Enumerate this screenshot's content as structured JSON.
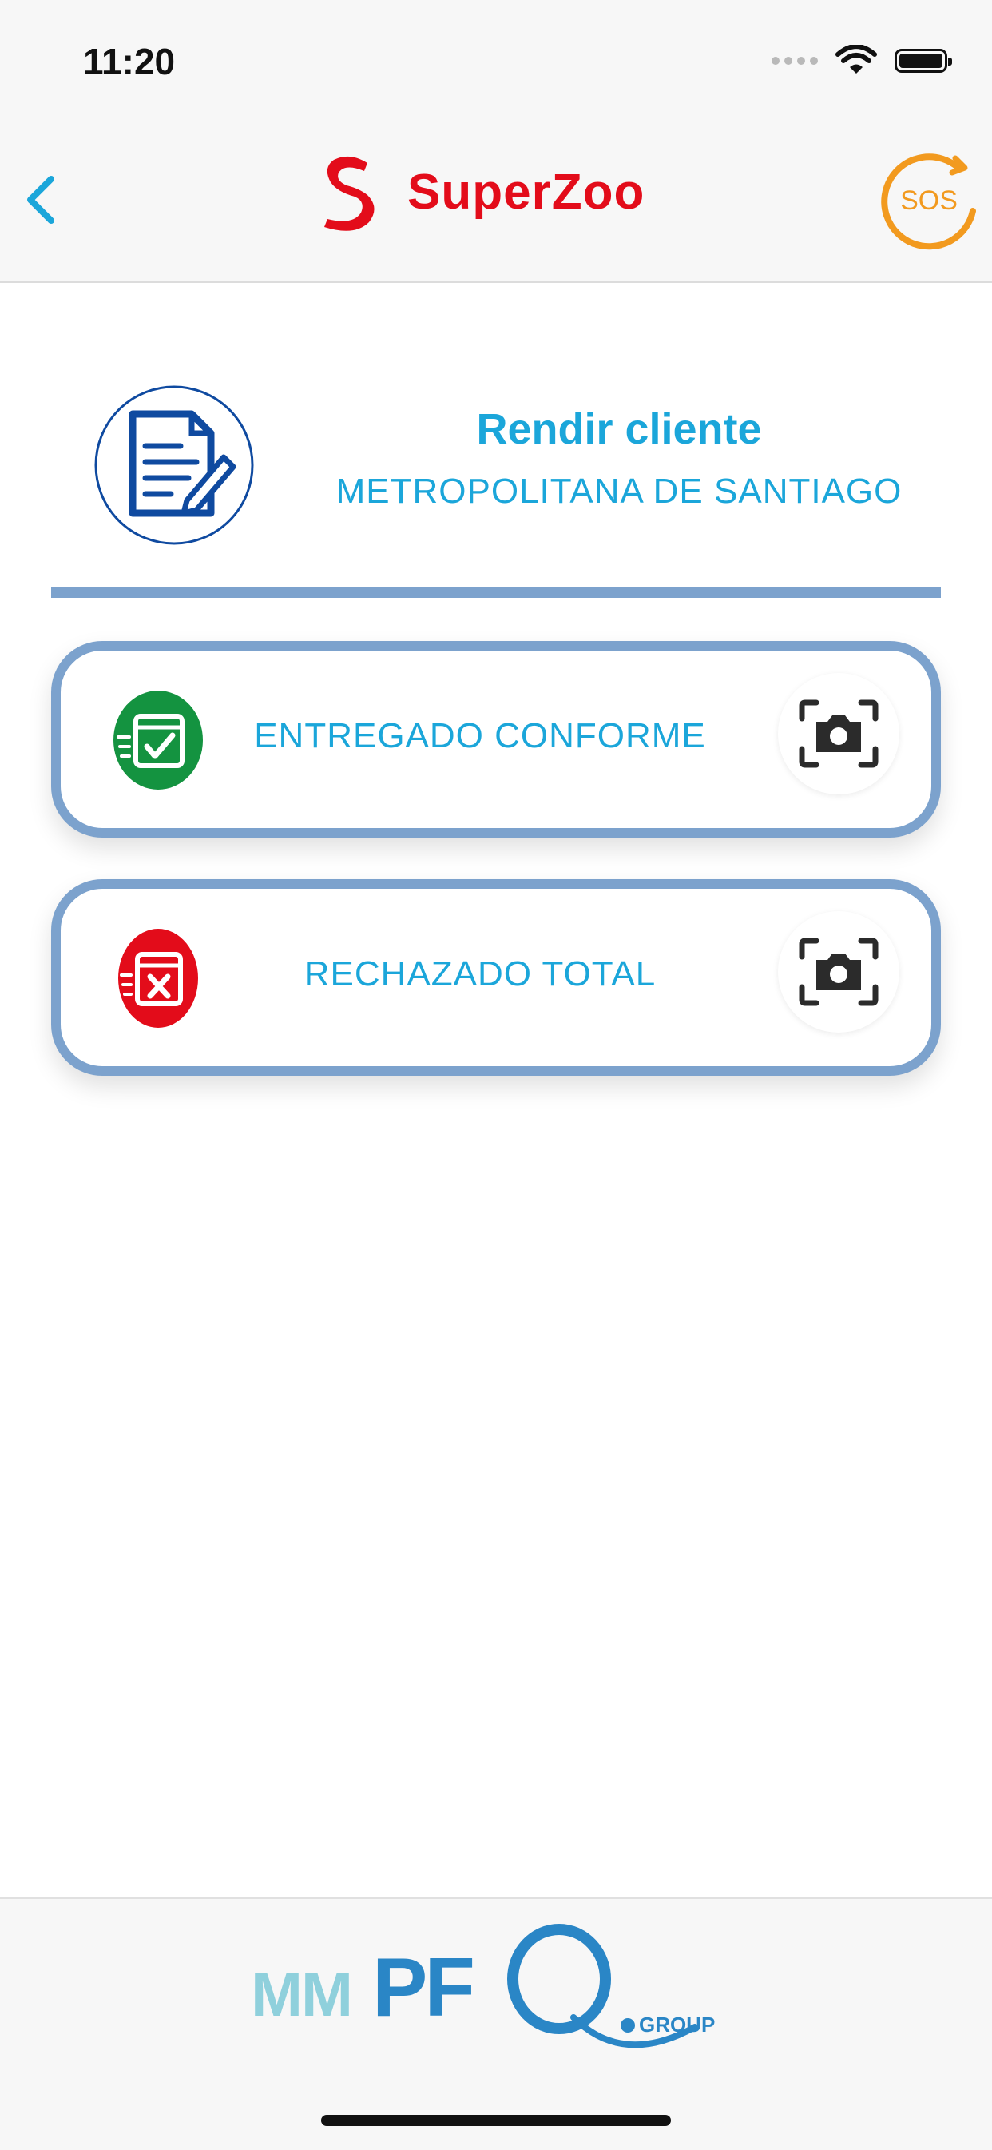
{
  "status_bar": {
    "time": "11:20"
  },
  "header": {
    "brand": "SuperZoo",
    "sos_label": "SOS",
    "accent_color": "#1ba6da",
    "brand_color": "#e30c1a",
    "sos_color": "#f29a1f"
  },
  "client": {
    "title": "Rendir cliente",
    "region": "METROPOLITANA DE SANTIAGO"
  },
  "options": [
    {
      "label": "ENTREGADO CONFORME",
      "icon": "delivery-ok-icon",
      "color": "#149340"
    },
    {
      "label": "RECHAZADO TOTAL",
      "icon": "delivery-rejected-icon",
      "color": "#e30c1a"
    }
  ],
  "footer": {
    "logo_text": "MMPFQ",
    "logo_suffix": "GROUP"
  }
}
